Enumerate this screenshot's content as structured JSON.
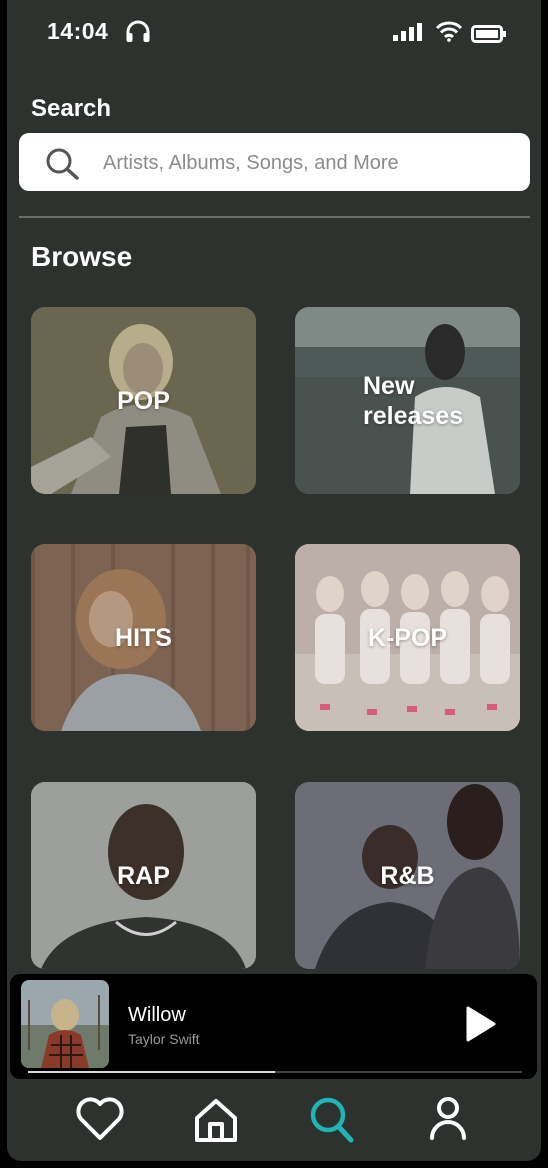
{
  "status_bar": {
    "time": "14:04"
  },
  "search": {
    "title": "Search",
    "placeholder": "Artists, Albums, Songs, and More"
  },
  "browse": {
    "title": "Browse",
    "tiles": [
      {
        "label": "POP",
        "bg": "#6f6a55"
      },
      {
        "label": "New\nreleases",
        "bg": "#5a6661"
      },
      {
        "label": "HITS",
        "bg": "#7a6656"
      },
      {
        "label": "K-POP",
        "bg": "#b9aba5"
      },
      {
        "label": "RAP",
        "bg": "#9a9e9b"
      },
      {
        "label": "R&B",
        "bg": "#6a6b72"
      }
    ]
  },
  "now_playing": {
    "title": "Willow",
    "artist": "Taylor Swift",
    "progress": 0.5
  },
  "bottom_nav": {
    "items": [
      "heart-icon",
      "home-icon",
      "search-icon",
      "profile-icon"
    ],
    "active": "search-icon",
    "accent": "#1fb5b5"
  }
}
